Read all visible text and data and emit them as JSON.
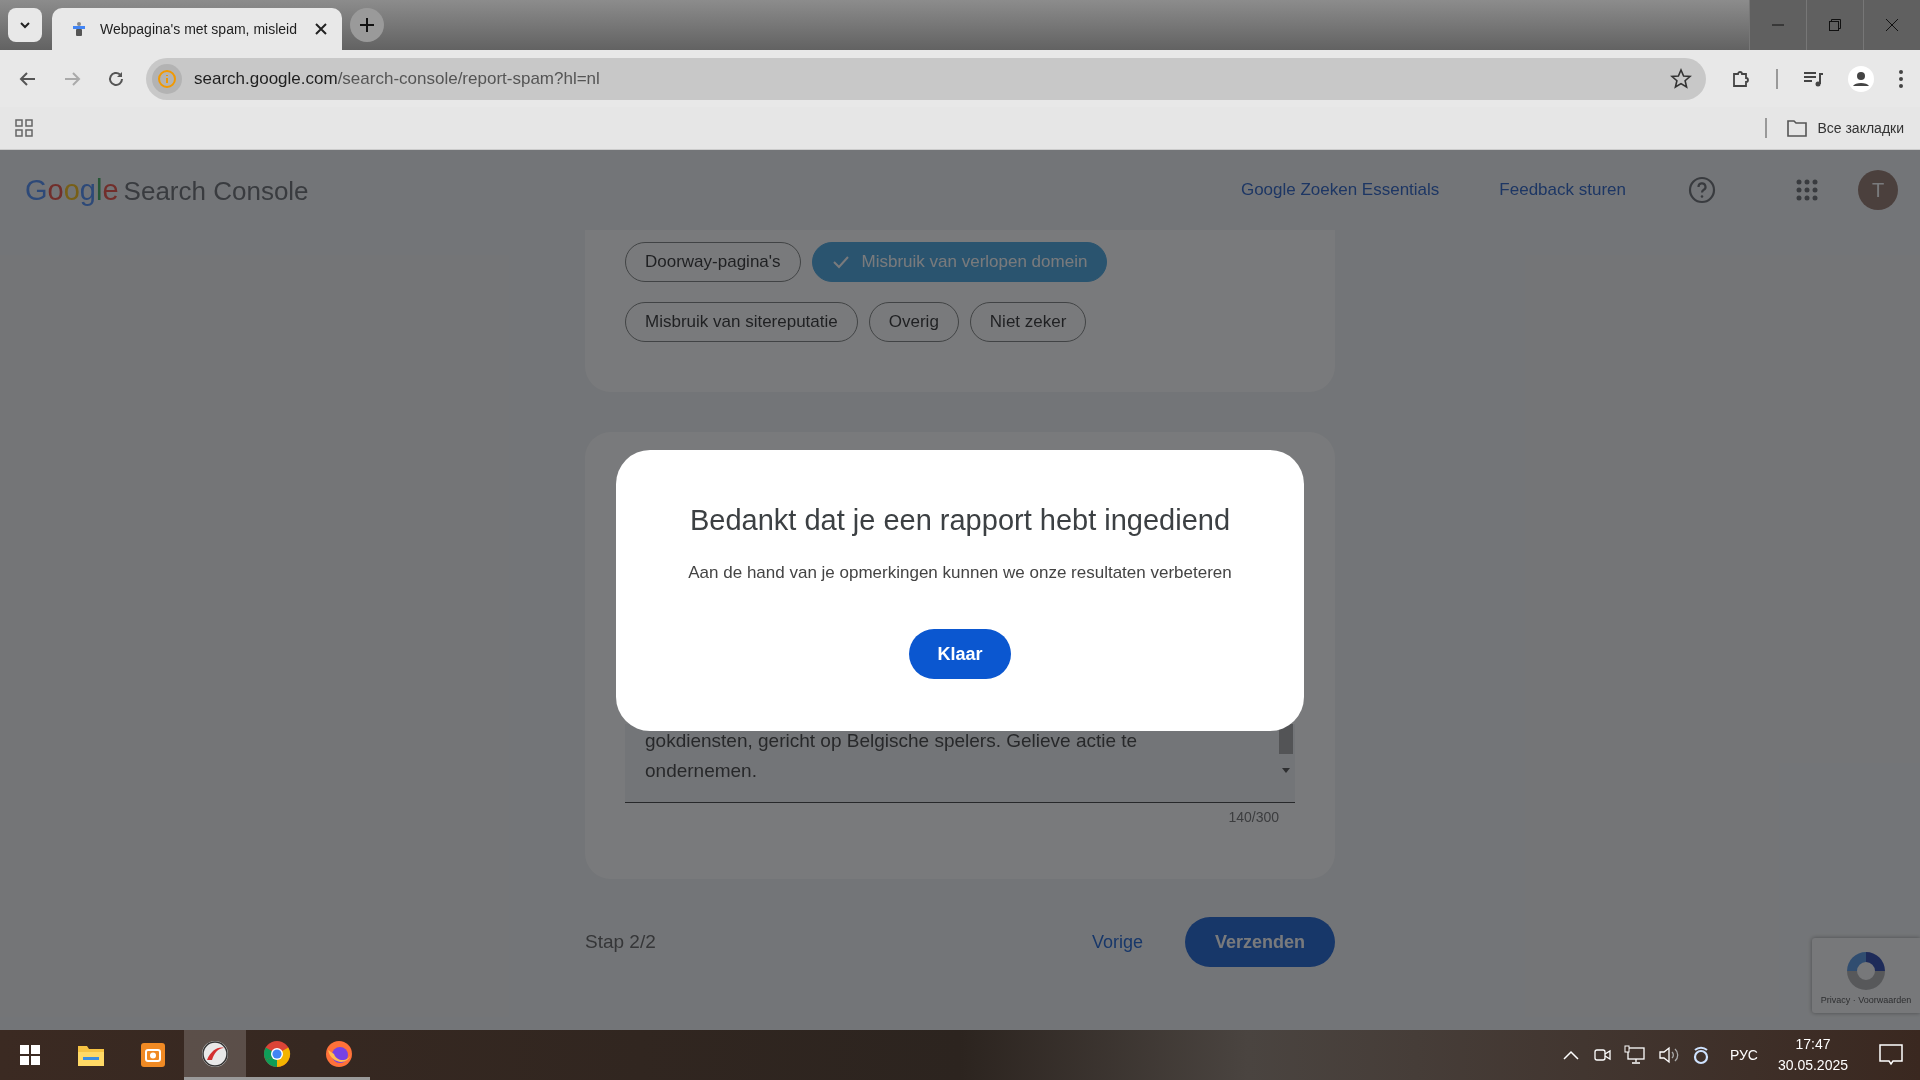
{
  "browser": {
    "tabs": [
      {
        "title": "Webpagina's met spam, misleid",
        "selected": true
      }
    ],
    "url": {
      "host": "search.google.com",
      "path": "/search-console/report-spam?hl=nl"
    },
    "bookmarks_label": "Все закладки"
  },
  "header": {
    "logo_word": "Google",
    "product": "Search Console",
    "links": [
      "Google Zoeken Essentials",
      "Feedback sturen"
    ],
    "avatar_letter": "T"
  },
  "chips": [
    [
      {
        "label": "Doorway-pagina's",
        "selected": false
      },
      {
        "label": "Misbruik van verlopen domein",
        "selected": true
      }
    ],
    [
      {
        "label": "Misbruik van sitereputatie",
        "selected": false
      },
      {
        "label": "Overig",
        "selected": false
      },
      {
        "label": "Niet zeker",
        "selected": false
      }
    ]
  ],
  "description": {
    "lines": [
      "gokdiensten, gericht op Belgische spelers. Gelieve actie te",
      "ondernemen."
    ],
    "counter": "140/300"
  },
  "footer": {
    "step": "Stap 2/2",
    "back": "Vorige",
    "submit": "Verzenden"
  },
  "dialog": {
    "title": "Bedankt dat je een rapport hebt ingediend",
    "message": "Aan de hand van je opmerkingen kunnen we onze resultaten verbeteren",
    "button": "Klaar"
  },
  "recaptcha": {
    "text": "Privacy · Voorwaarden"
  },
  "taskbar": {
    "apps": [
      {
        "kind": "folder",
        "running": false,
        "active": false
      },
      {
        "kind": "camera",
        "running": false,
        "active": false
      },
      {
        "kind": "swirl",
        "running": true,
        "active": true
      },
      {
        "kind": "chrome",
        "running": true,
        "active": false
      },
      {
        "kind": "firefox",
        "running": true,
        "active": false
      }
    ],
    "language": "РУС",
    "time": "17:47",
    "date": "30.05.2025"
  }
}
